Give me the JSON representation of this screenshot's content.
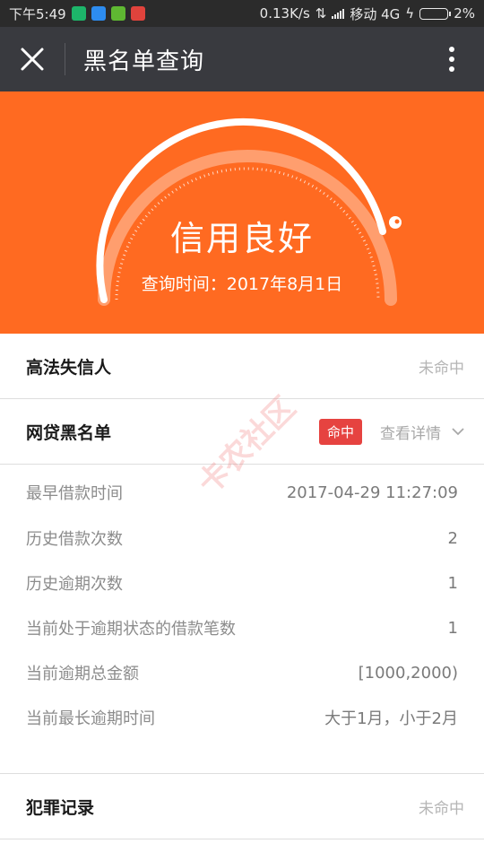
{
  "status_bar": {
    "time": "下午5:49",
    "network_speed": "0.13K/s",
    "carrier": "移动 4G",
    "battery": "2%"
  },
  "header": {
    "title": "黑名单查询"
  },
  "hero": {
    "status": "信用良好",
    "query_time_label": "查询时间：2017年8月1日",
    "background_color": "#ff6a21"
  },
  "sections": {
    "court": {
      "title": "高法失信人",
      "status": "未命中"
    },
    "loan_blacklist": {
      "title": "网贷黑名单",
      "badge": "命中",
      "badge_color": "#e64340",
      "detail_link": "查看详情"
    },
    "criminal": {
      "title": "犯罪记录",
      "status": "未命中"
    }
  },
  "loan_details": [
    {
      "label": "最早借款时间",
      "value": "2017-04-29 11:27:09"
    },
    {
      "label": "历史借款次数",
      "value": "2"
    },
    {
      "label": "历史逾期次数",
      "value": "1"
    },
    {
      "label": "当前处于逾期状态的借款笔数",
      "value": "1"
    },
    {
      "label": "当前逾期总金额",
      "value": "[1000,2000)"
    },
    {
      "label": "当前最长逾期时间",
      "value": "大于1月，小于2月"
    }
  ],
  "watermark": "卡农社区"
}
